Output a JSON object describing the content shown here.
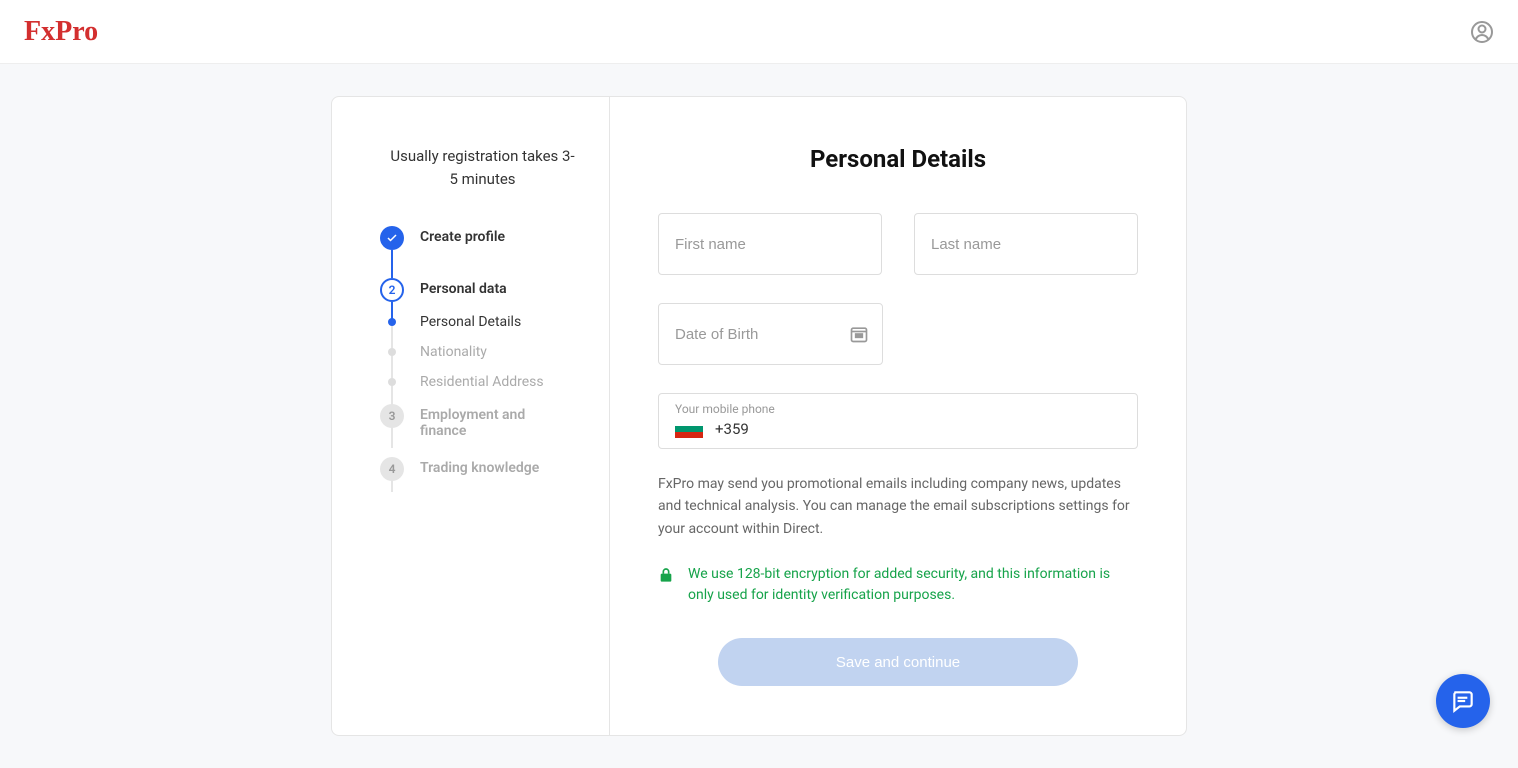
{
  "header": {
    "logo": "FxPro"
  },
  "sidebar": {
    "title": "Usually registration takes 3-5 minutes",
    "steps": [
      {
        "label": "Create profile",
        "state": "completed"
      },
      {
        "label": "Personal data",
        "state": "active",
        "number": "2",
        "substeps": [
          {
            "label": "Personal Details",
            "active": true
          },
          {
            "label": "Nationality",
            "active": false
          },
          {
            "label": "Residential Address",
            "active": false
          }
        ]
      },
      {
        "label": "Employment and finance",
        "state": "inactive",
        "number": "3"
      },
      {
        "label": "Trading knowledge",
        "state": "inactive",
        "number": "4"
      }
    ]
  },
  "main": {
    "title": "Personal Details",
    "firstname_placeholder": "First name",
    "lastname_placeholder": "Last name",
    "dob_placeholder": "Date of Birth",
    "phone_label": "Your mobile phone",
    "phone_value": "+359",
    "disclaimer": "FxPro may send you promotional emails including company news, updates and technical analysis. You can manage the email subscriptions settings for your account within Direct.",
    "security_text": "We use 128-bit encryption for added security, and this information is only used for identity verification purposes.",
    "submit_label": "Save and continue"
  }
}
